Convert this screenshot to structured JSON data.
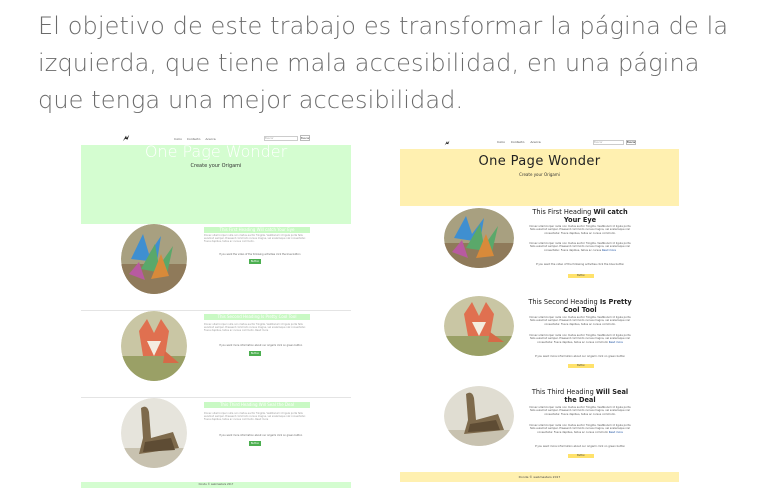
{
  "intro": {
    "text": "El objetivo de este trabajo es transformar la página de la izquierda, que tiene mala accesibilidad, en una página que tenga una mejor accesibilidad."
  },
  "left": {
    "nav": {
      "links": [
        "Inicio",
        "Contacto",
        "Acerca"
      ],
      "search_placeholder": "Buscar",
      "search_button": "Buscar"
    },
    "hero": {
      "title": "One Page Wonder",
      "subtitle": "Create your Origami"
    },
    "sections": [
      {
        "heading": "This First Heading Will catch Your Eye",
        "text": "Donec ullamcorper nulla non metus auctor fringilla. Vestibulum id ligula porta felis euismod semper. Praesent commodo cursus magna, vel scelerisque nisl consectetur. Fusce dapibus, tellus ac cursus commodo.",
        "question": "If you want the video of the following activities click the blue button",
        "button": "Button"
      },
      {
        "heading": "This Second Heading Is Pretty Cool Tool",
        "text": "Donec ullamcorper nulla non metus auctor fringilla. Vestibulum id ligula porta felis euismod semper. Praesent commodo cursus magna, vel scelerisque nisl consectetur. Fusce dapibus, tellus ac cursus commodo. Read more",
        "question": "If you want more information about our origami click on green button",
        "button": "Button"
      },
      {
        "heading": "This Third Heading Will Seal the Deal",
        "text": "Donec ullamcorper nulla non metus auctor fringilla. Vestibulum id ligula porta felis euismod semper. Praesent commodo cursus magna, vel scelerisque nisl consectetur. Fusce dapibus, tellus ac cursus commodo. Read more",
        "question": "If you want more information about our origami click on green button",
        "button": "Button"
      }
    ],
    "footer": "Donde © webmasters 2017"
  },
  "right": {
    "nav": {
      "links": [
        "Inicio",
        "Contacto",
        "Acerca"
      ],
      "search_placeholder": "Buscar",
      "search_button": "Buscar"
    },
    "hero": {
      "title": "One Page Wonder",
      "subtitle": "Create your Origami"
    },
    "sections": [
      {
        "heading_pre": "This First Heading ",
        "heading_bold": "Wil catch Your Eye",
        "text": "Donec ullamcorper nulla non metus auctor fringilla. Vestibulum id ligula porta felis euismod semper. Praesent commodo cursus magna, vel scelerisque nisl consectetur. Fusce dapibus, tellus ac cursus commodo.",
        "text2": "Donec ullamcorper nulla non metus auctor fringilla. Vestibulum id ligula porta felis euismod semper. Praesent commodo cursus magna, vel scelerisque nisl consectetur. Fusce dapibus, tellus ac cursus ",
        "link": "Read more",
        "question": "If you want the video of the following activities click the blue button",
        "button": "Button"
      },
      {
        "heading_pre": "This Second Heading ",
        "heading_bold": "Is Pretty Cool Tool",
        "text": "Donec ullamcorper nulla non metus auctor fringilla. Vestibulum id ligula porta felis euismod semper. Praesent commodo cursus magna, vel scelerisque nisl consectetur. Fusce dapibus, tellus ac cursus commodo.",
        "text2": "Donec ullamcorper nulla non metus auctor fringilla. Vestibulum id ligula porta felis euismod semper. Praesent commodo cursus magna, vel scelerisque nisl consectetur. Fusce dapibus, tellus ac cursus commodo ",
        "link": "Read more",
        "question": "If you want more information about our origami click on green button",
        "button": "Button"
      },
      {
        "heading_pre": "This Third Heading ",
        "heading_bold": "Will Seal the Deal",
        "text": "Donec ullamcorper nulla non metus auctor fringilla. Vestibulum id ligula porta felis euismod semper. Praesent commodo cursus magna, vel scelerisque nisl consectetur. Fusce dapibus, tellus ac cursus commodo.",
        "text2": "Donec ullamcorper nulla non metus auctor fringilla. Vestibulum id ligula porta felis euismod semper. Praesent commodo cursus magna, vel scelerisque nisl consectetur. Fusce dapibus, tellus ac cursus commodo ",
        "link": "Read more",
        "question": "If you want more information about our origami click on green button",
        "button": "Button"
      }
    ],
    "footer": "Donde © webmasters 2017"
  },
  "colors": {
    "left_accent": "#d4fdd0",
    "left_button": "#4caf50",
    "right_accent": "#fff0b0",
    "right_button": "#ffe26b",
    "intro_text": "#6b6b6b"
  },
  "icons": {
    "logo": "crane-logo-icon",
    "section_images": [
      "origami-cranes-photo",
      "origami-fox-photo",
      "origami-swan-photo"
    ]
  }
}
